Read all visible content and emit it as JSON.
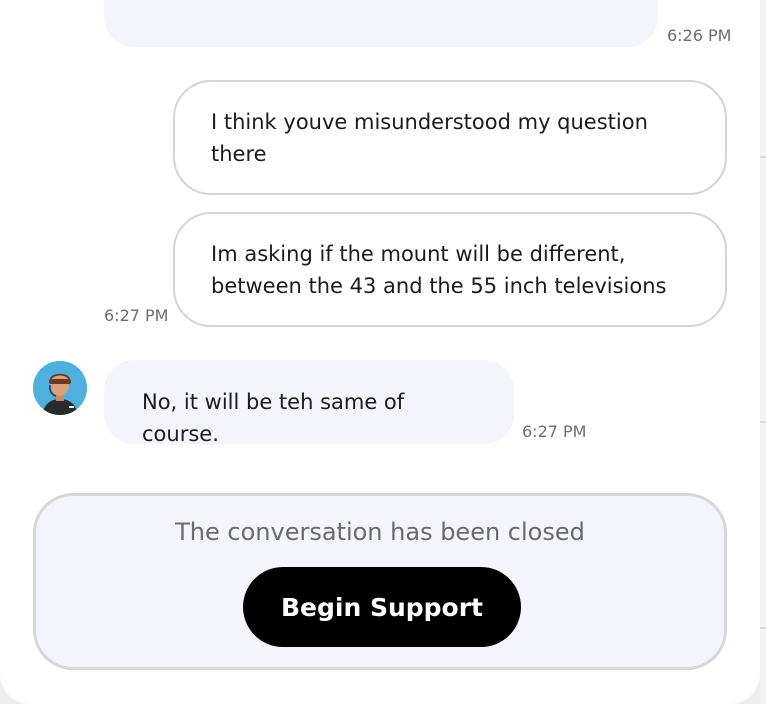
{
  "messages": [
    {
      "sender": "agent",
      "text": "",
      "time": "6:26 PM"
    },
    {
      "sender": "user",
      "text": "I think youve misunderstood my question there"
    },
    {
      "sender": "user",
      "text": "Im asking if the mount will be different, between the 43 and the 55 inch televisions",
      "time": "6:27 PM"
    },
    {
      "sender": "agent",
      "text": "No, it will be teh same of course.",
      "time": "6:27 PM"
    }
  ],
  "closed": {
    "text": "The conversation has been closed",
    "button_label": "Begin Support"
  },
  "colors": {
    "agent_bubble": "#f4f5fc",
    "user_border": "#d4d4d4",
    "button": "#000000"
  }
}
